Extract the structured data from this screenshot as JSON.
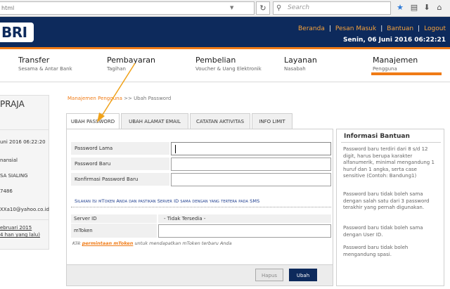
{
  "browser": {
    "url_fragment": "html",
    "search_placeholder": "Search"
  },
  "header": {
    "logo_text": "BRI",
    "links": [
      "Beranda",
      "Pesan Masuk",
      "Bantuan",
      "Logout"
    ],
    "date": "Senin, 06 Juni 2016 06:22:21"
  },
  "nav": [
    {
      "title": "Transfer",
      "sub": "Sesama & Antar Bank"
    },
    {
      "title": "Pembayaran",
      "sub": "Tagihan"
    },
    {
      "title": "Pembelian",
      "sub": "Voucher & Uang Elektronik"
    },
    {
      "title": "Layanan",
      "sub": "Nasabah"
    },
    {
      "title": "Manajemen",
      "sub": "Pengguna"
    }
  ],
  "sidebar": {
    "name": "PRAJA",
    "rows": [
      "uni 2016 06:22:20",
      "nansial",
      "SA SIALING",
      "7486",
      "XXa10@yahoo.co.id",
      "ebruari 2015",
      "4 han yang lalu)"
    ]
  },
  "breadcrumb": {
    "link": "Manajemen Pengguna",
    "sep": ">>",
    "current": "Ubah Password"
  },
  "tabs": [
    "UBAH PASSWORD",
    "UBAH ALAMAT EMAIL",
    "CATATAN AKTIVITAS",
    "INFO LIMIT"
  ],
  "form": {
    "fields": [
      "Password Lama",
      "Password Baru",
      "Konfirmasi Password Baru"
    ],
    "sms_note": "Silakan Isi mToken Anda dan pastikan Server ID sama dengan yang tertera pada SMS",
    "server_label": "Server ID",
    "server_value": "- Tidak Tersedia -",
    "mtoken_label": "mToken",
    "click_prefix": "Klik",
    "click_link": "permintaan mToken",
    "click_suffix": "untuk mendapatkan mToken terbaru Anda"
  },
  "buttons": {
    "reset": "Hapus",
    "submit": "Ubah"
  },
  "help": {
    "title": "Informasi Bantuan",
    "paragraphs": [
      "Password baru terdiri dari 8 s/d 12 digit, harus berupa karakter alfanumerik, minimal mengandung 1 huruf dan 1 angka, serta case sensitive (Contoh: Bandung1)",
      "Password baru tidak boleh sama dengan salah satu dari 3 password terakhir yang pernah digunakan.",
      "Password baru tidak boleh sama dengan User ID.",
      "Password baru tidak boleh mengandung spasi."
    ]
  },
  "colors": {
    "brand_navy": "#0d2a5c",
    "accent_orange": "#f07b16"
  }
}
